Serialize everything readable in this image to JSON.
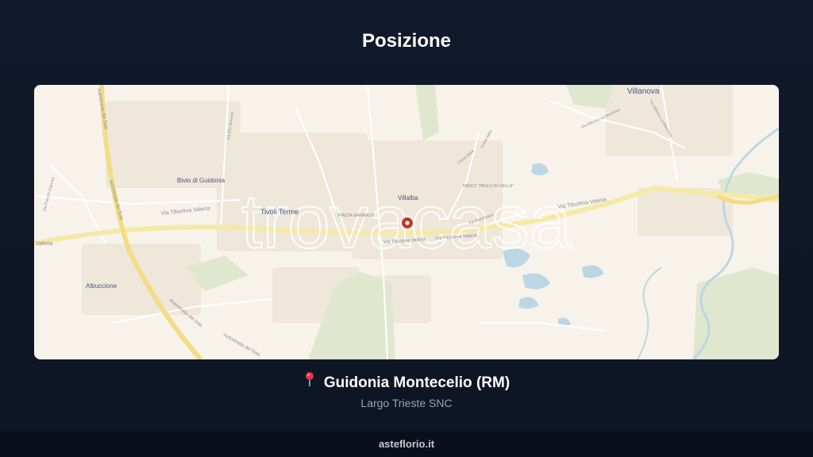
{
  "header": {
    "title": "Posizione"
  },
  "map": {
    "watermark": "trovacasa",
    "places": {
      "villanova": "Villanova",
      "bivio": "Bivio di Guidonia",
      "tivoli_terme": "Tivoli Terme",
      "villalba": "Villalba",
      "albuccione": "Albuccione",
      "piazza": "PIAZZA GARIBALDI",
      "parco": "PARCO \"PAOLO DI VIELLA\""
    },
    "roads": {
      "tiburtina_left": "Via Tiburtina Valeria",
      "tiburtina_center": "Via Tiburtina Valeria",
      "tiburtina_center2": "Via Tiburtina Valeria",
      "tiburtina_right": "Via Tiburtina Valeria",
      "valeria_edge": "Valeria",
      "autostrada_1": "Autostrada del Sole",
      "autostrada_2": "Autostrada del Sole",
      "autostrada_3": "Autostrada del Sole",
      "autostrada_4": "Autostrada del Sole",
      "elio_morante": "Via Elio Morante",
      "corso_italia": "Corso Italia",
      "via_palombara": "Via Palombara",
      "alfonso_lamarmora": "Via Alfonso La Marmora",
      "la_marmora_side": "Via Alfonso La Marmora",
      "corso_italia2": "Corso Italia",
      "via_franchi": "Via Franchi Giannini"
    },
    "colors": {
      "road_major": "#f6e9a6",
      "water": "#bcd7e4",
      "green": "#dfe8cf",
      "pin": "#c0392b"
    }
  },
  "location": {
    "city": "Guidonia Montecelio (RM)",
    "address": "Largo Trieste SNC"
  },
  "footer": {
    "brand": "asteflorio.it"
  }
}
